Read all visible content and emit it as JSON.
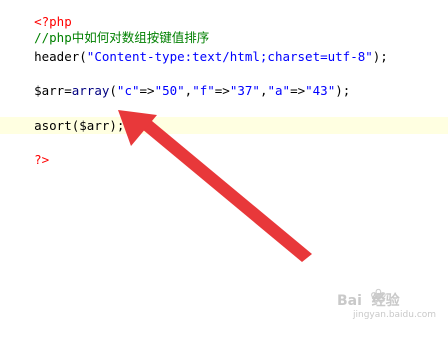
{
  "code": {
    "line1_tag": "<?php",
    "line2_comment_prefix": "//php",
    "line2_comment_text": "中如何对数组按键值排序",
    "line3": {
      "fn": "header(",
      "arg": "\"Content-type:text/html;charset=utf-8\"",
      "end": ");"
    },
    "line5": {
      "var": "$arr=",
      "kw": "array",
      "open": "(",
      "k1": "\"c\"",
      "op1": "=>",
      "v1": "\"50\"",
      "sep1": ",",
      "k2": "\"f\"",
      "op2": "=>",
      "v2": "\"37\"",
      "sep2": ",",
      "k3": "\"a\"",
      "op3": "=>",
      "v3": "\"43\"",
      "close": ");"
    },
    "line7": "asort($arr);",
    "line9_tag": "?>"
  },
  "watermark": {
    "brand": "Bai  经验",
    "site": "jingyan.baidu.com"
  },
  "colors": {
    "tag": "#ff0000",
    "comment": "#008000",
    "string": "#0000ff",
    "highlight": "#ffffe1",
    "arrow": "#e8383a"
  },
  "icons": [
    "baidu-paw-icon"
  ]
}
